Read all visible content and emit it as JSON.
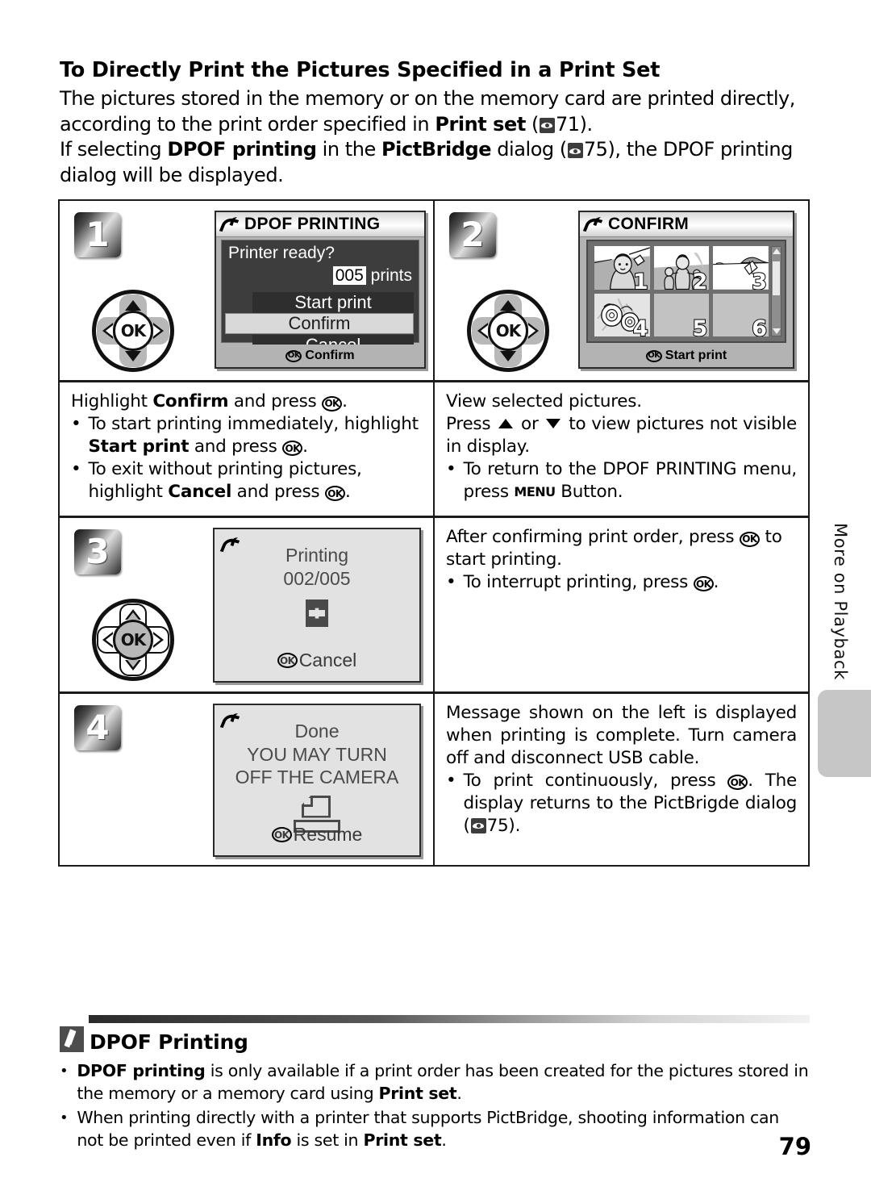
{
  "page": {
    "number": "79",
    "side_tab": "More on Playback"
  },
  "intro": {
    "heading": "To Directly Print the Pictures Specified in a Print Set",
    "para1_a": "The pictures stored in the memory or on the memory card are printed directly, according to the print order specified in ",
    "para1_b": "Print set",
    "para1_c": " (",
    "para1_ref": "71).",
    "para2_a": "If selecting ",
    "para2_b": "DPOF printing",
    "para2_c": " in the ",
    "para2_d": "PictBridge",
    "para2_e": " dialog (",
    "para2_ref": "75), the DPOF printing dialog will be displayed."
  },
  "steps": [
    {
      "number": "1",
      "screen": {
        "title": "DPOF PRINTING",
        "line1": "Printer ready?",
        "count": "005",
        "count_suffix": "prints",
        "items": [
          "Start print",
          "Confirm",
          "Cancel"
        ],
        "footer": "Confirm"
      },
      "text": {
        "lead_a": "Highlight ",
        "lead_b": "Confirm",
        "lead_c": " and press ",
        "lead_d": ".",
        "b1_a": "To start printing immediately, highlight ",
        "b1_b": "Start print",
        "b1_c": " and press ",
        "b1_d": ".",
        "b2_a": "To exit without printing pictures, highlight ",
        "b2_b": "Cancel",
        "b2_c": " and press ",
        "b2_d": "."
      }
    },
    {
      "number": "2",
      "screen": {
        "title": "CONFIRM",
        "thumbnails": [
          "1",
          "2",
          "3",
          "4",
          "5",
          "6"
        ],
        "footer": "Start print"
      },
      "text": {
        "lead1": "View selected pictures.",
        "lead2_a": "Press ",
        "lead2_b": " or ",
        "lead2_c": " to view pictures not visible in display.",
        "b1_a": "To return to the DPOF PRINTING menu, press ",
        "b1_menu": "MENU",
        "b1_b": " Button."
      }
    },
    {
      "number": "3",
      "screen": {
        "line1": "Printing",
        "line2": "002/005",
        "icon": "hourglass-icon",
        "footer": "Cancel"
      },
      "text": {
        "lead": "After confirming print order, press ",
        "lead_b": " to start printing.",
        "b1_a": "To interrupt printing, press ",
        "b1_b": "."
      }
    },
    {
      "number": "4",
      "screen": {
        "line1": "Done",
        "line2": "YOU MAY TURN",
        "line3": "OFF THE CAMERA",
        "icon": "printer-icon",
        "footer": "Resume"
      },
      "text": {
        "lead": "Message shown on the left is displayed when printing is complete. Turn camera off and disconnect USB cable.",
        "b1_a": "To print continuously, press ",
        "b1_b": ". The display returns to the PictBrigde dialog (",
        "b1_ref": "75)."
      }
    }
  ],
  "note": {
    "title": "DPOF Printing",
    "items": [
      {
        "a": "DPOF printing",
        "b": " is only available if a print order has been created for the pictures stored in the memory or a memory card using ",
        "c": "Print set",
        "d": "."
      },
      {
        "a": "When printing directly with a printer that supports PictBridge, shooting information can not be printed even if ",
        "b": "Info",
        "c": " is set in ",
        "d": "Print set",
        "e": "."
      }
    ]
  },
  "glyphs": {
    "ok": "OK",
    "bullet": "•"
  }
}
